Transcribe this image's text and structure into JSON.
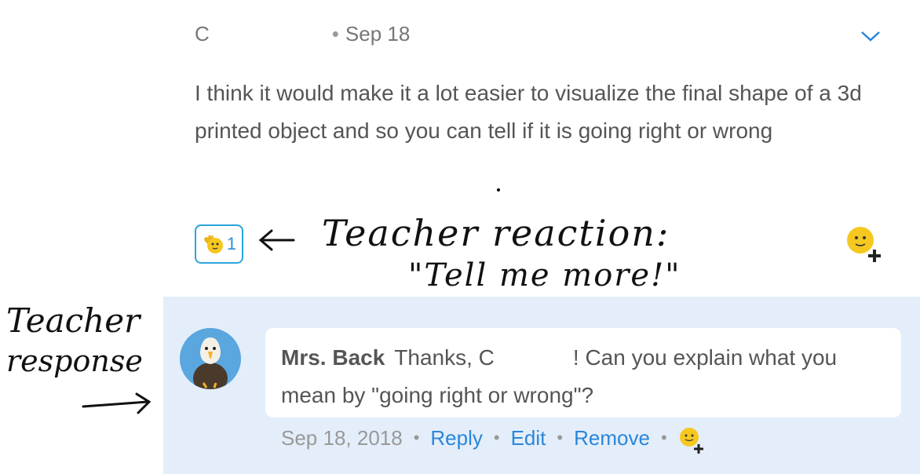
{
  "post": {
    "author_initial": "C",
    "separator": "•",
    "date": "Sep 18",
    "body": "I think it would make it a lot easier to visualize the final shape of a 3d printed object and so you can tell if it is going right or wrong",
    "reaction": {
      "icon": "waving-hand-emoji-icon",
      "count": "1"
    }
  },
  "annotations": {
    "reaction_line1": "Teacher reaction:",
    "reaction_line2": "\"Tell me more!\"",
    "response_line1": "Teacher",
    "response_line2": "response"
  },
  "reply": {
    "author": "Mrs. Back",
    "text_start": "Thanks, C",
    "text_end": "! Can you explain what you mean by \"going right or wrong\"?",
    "date": "Sep 18, 2018",
    "separator": "•",
    "reply_label": "Reply",
    "edit_label": "Edit",
    "remove_label": "Remove"
  },
  "colors": {
    "accent": "#2a86d9",
    "reply_panel": "#e3eefa",
    "avatar_bg": "#5aa6df",
    "emoji": "#f5c820"
  }
}
